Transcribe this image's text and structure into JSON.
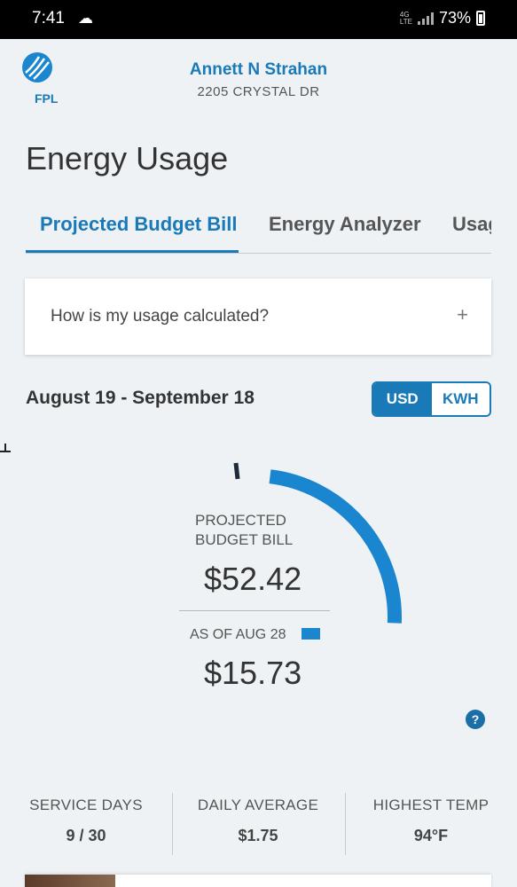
{
  "status_bar": {
    "time": "7:41",
    "battery": "73%",
    "weather_icon": "cloud-sun-icon",
    "signal_icon": "signal-icon",
    "battery_icon": "battery-icon"
  },
  "header": {
    "logo_text": "FPL",
    "user_name": "Annett N Strahan",
    "address": "2205 CRYSTAL DR"
  },
  "page": {
    "title": "Energy Usage"
  },
  "tabs": [
    {
      "label": "Projected Budget Bill",
      "active": true
    },
    {
      "label": "Energy Analyzer",
      "active": false
    },
    {
      "label": "Usage",
      "active": false
    }
  ],
  "faq": {
    "question": "How is my usage calculated?",
    "expand_icon": "+"
  },
  "billing_period": {
    "date_range": "August 19 - September 18"
  },
  "unit_toggle": {
    "options": [
      "USD",
      "KWH"
    ],
    "selected": "USD"
  },
  "gauge": {
    "projected_label_line1": "PROJECTED",
    "projected_label_line2": "BUDGET BILL",
    "projected_amount": "$52.42",
    "as_of_label": "AS OF AUG 28",
    "as_of_amount": "$15.73",
    "progress_fraction": 0.3,
    "progress_color": "#1a86d0"
  },
  "stats": [
    {
      "label": "SERVICE DAYS",
      "value": "9 / 30"
    },
    {
      "label": "DAILY AVERAGE",
      "value": "$1.75"
    },
    {
      "label": "HIGHEST TEMP",
      "value": "94°F"
    }
  ],
  "colors": {
    "brand": "#1a7ab8",
    "background": "#eef2f4"
  }
}
